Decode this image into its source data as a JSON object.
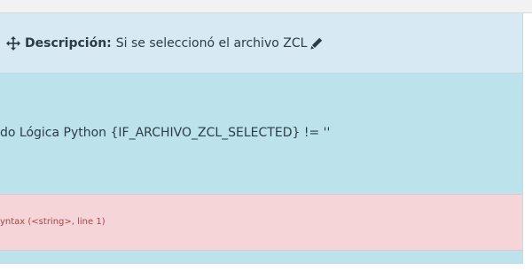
{
  "header": {
    "label": "Descripción:",
    "value": "Si se seleccionó el archivo ZCL",
    "move_icon": "move-arrows-icon",
    "edit_icon": "pencil-icon"
  },
  "body": {
    "text": "do Lógica Python {IF_ARCHIVO_ZCL_SELECTED} != ''"
  },
  "error": {
    "text": "yntax (<string>, line 1)"
  },
  "colors": {
    "header_bg": "#d7e9f2",
    "body_bg": "#bce3ec",
    "error_bg": "#f6d5d8",
    "error_text": "#a94442"
  }
}
